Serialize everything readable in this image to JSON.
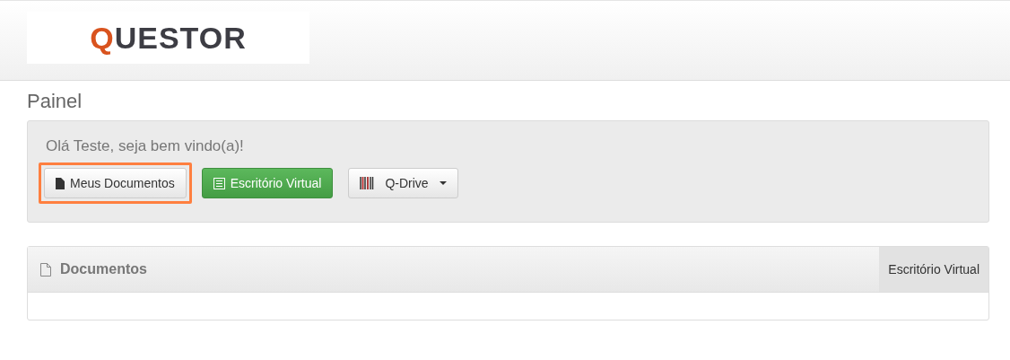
{
  "header": {
    "logo": "QUESTOR"
  },
  "page_title": "Painel",
  "welcome": {
    "greeting": "Olá Teste, seja bem vindo(a)!",
    "buttons": [
      {
        "kind": "document",
        "label": "Meus Documentos",
        "highlighted": true
      },
      {
        "kind": "list",
        "label": "Escritório Virtual",
        "highlighted": false
      },
      {
        "kind": "dropdown",
        "label": "Q-Drive",
        "highlighted": false
      }
    ]
  },
  "panel": {
    "title": "Documentos",
    "tabs": [
      {
        "label": "Escritório Virtual",
        "selected": true
      }
    ]
  }
}
